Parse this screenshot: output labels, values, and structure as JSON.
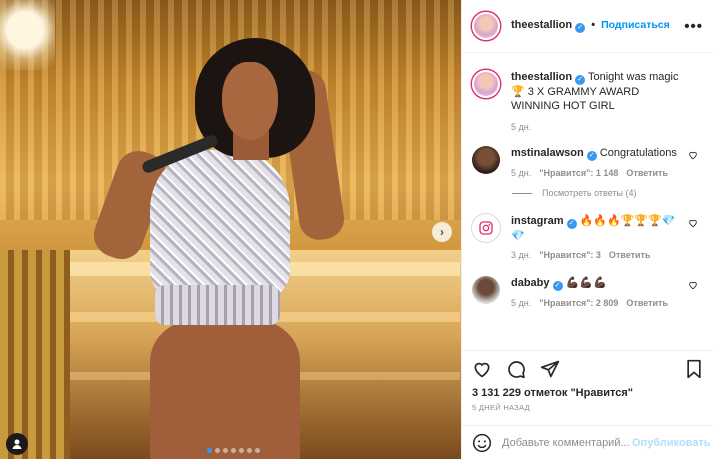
{
  "post": {
    "username": "theestallion",
    "follow_label": "Подписаться",
    "separator": "•",
    "more_label": "•••"
  },
  "caption": {
    "username": "theestallion",
    "text": "Tonight was magic 🏆 3 X GRAMMY AWARD WINNING HOT GIRL",
    "time": "5 дн."
  },
  "comments": [
    {
      "username": "mstinalawson",
      "text": "Congratulations",
      "time": "5 дн.",
      "likes": "\"Нравится\": 1 148",
      "reply": "Ответить"
    },
    {
      "username": "instagram",
      "text": "🔥🔥🔥🏆🏆🏆💎💎",
      "time": "3 дн.",
      "likes": "\"Нравится\": 3",
      "reply": "Ответить"
    },
    {
      "username": "dababy",
      "text": "💪🏿💪🏿💪🏿",
      "time": "5 дн.",
      "likes": "\"Нравится\": 2 809",
      "reply": "Ответить"
    }
  ],
  "view_replies": "Посмотреть ответы (4)",
  "likes_count": "3 131 229 отметок \"Нравится\"",
  "time_ago": "5 ДНЕЙ НАЗАД",
  "add_comment": {
    "placeholder": "Добавьте комментарий...",
    "publish_label": "Опубликовать"
  },
  "carousel": {
    "slides": 7,
    "active": 0
  },
  "colors": {
    "accent": "#0095f6",
    "verified": "#3897f0",
    "publish_disabled": "#b2dffc",
    "muted": "#8e8e8e"
  }
}
